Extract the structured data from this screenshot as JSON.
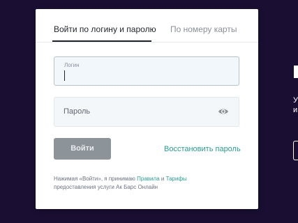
{
  "tabs": {
    "login_tab": "Войти по логину и паролю",
    "card_tab": "По номеру карты"
  },
  "form": {
    "login_label": "Логин",
    "login_value": "",
    "password_placeholder": "Пароль"
  },
  "actions": {
    "submit_label": "Войти",
    "restore_label": "Восстановить пароль"
  },
  "terms": {
    "prefix": "Нажимая «Войти», я принимаю ",
    "rules_link": "Правила",
    "and": " и ",
    "tariffs_link": "Тарифы",
    "suffix": "предоставления услуги Ак Барс Онлайн"
  },
  "side": {
    "text_line1": "У",
    "text_line2": "и"
  },
  "colors": {
    "background": "#1a0f33",
    "accent_link": "#2a9d8f",
    "button_disabled": "#8c9399"
  },
  "icons": {
    "password_toggle": "eye-icon"
  }
}
